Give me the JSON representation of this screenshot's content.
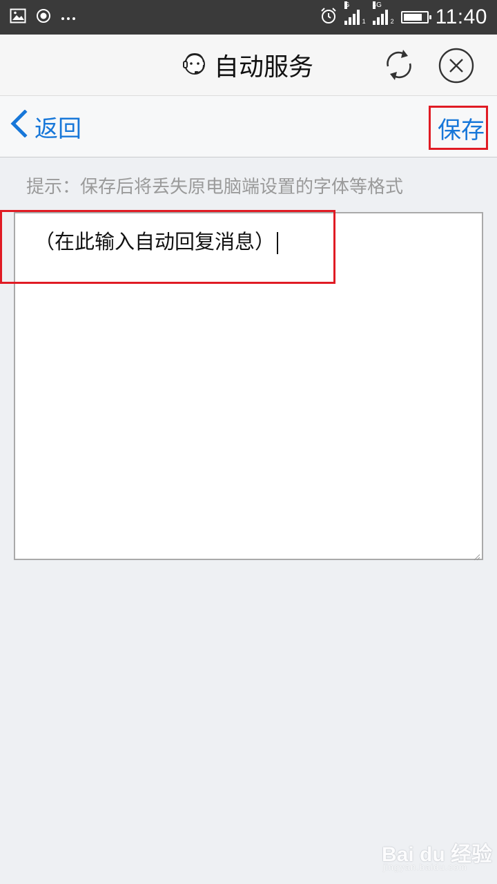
{
  "status_bar": {
    "time": "11:40",
    "icons": [
      "image-icon",
      "record-icon",
      "more-icon",
      "alarm-icon",
      "signal-icon",
      "signal-icon",
      "battery-icon"
    ],
    "signal1_label": "G",
    "signal1_sub": "1",
    "signal2_label": "4G",
    "signal2_sub": "2",
    "battery_level": 0.85
  },
  "titlebar": {
    "title": "自动服务",
    "icon": "customer-service-icon",
    "refresh_icon": "refresh-icon",
    "close_icon": "close-icon"
  },
  "navbar": {
    "back_label": "返回",
    "save_label": "保存"
  },
  "hint": "提示：保存后将丢失原电脑端设置的字体等格式",
  "editor": {
    "value": "（在此输入自动回复消息）"
  },
  "watermark": {
    "main": "Bai du 经验",
    "sub": "jingyan.baidu.com"
  },
  "colors": {
    "accent": "#1777d9",
    "highlight": "#e01b24",
    "status_bar": "#3a3a3a",
    "background": "#eef0f3"
  }
}
